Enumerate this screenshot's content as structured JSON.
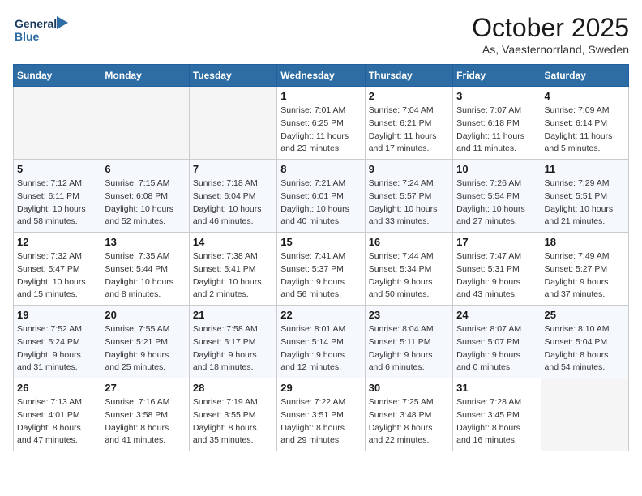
{
  "header": {
    "logo_line1": "General",
    "logo_line2": "Blue",
    "month": "October 2025",
    "location": "As, Vaesternorrland, Sweden"
  },
  "weekdays": [
    "Sunday",
    "Monday",
    "Tuesday",
    "Wednesday",
    "Thursday",
    "Friday",
    "Saturday"
  ],
  "weeks": [
    [
      {
        "day": "",
        "info": ""
      },
      {
        "day": "",
        "info": ""
      },
      {
        "day": "",
        "info": ""
      },
      {
        "day": "1",
        "info": "Sunrise: 7:01 AM\nSunset: 6:25 PM\nDaylight: 11 hours\nand 23 minutes."
      },
      {
        "day": "2",
        "info": "Sunrise: 7:04 AM\nSunset: 6:21 PM\nDaylight: 11 hours\nand 17 minutes."
      },
      {
        "day": "3",
        "info": "Sunrise: 7:07 AM\nSunset: 6:18 PM\nDaylight: 11 hours\nand 11 minutes."
      },
      {
        "day": "4",
        "info": "Sunrise: 7:09 AM\nSunset: 6:14 PM\nDaylight: 11 hours\nand 5 minutes."
      }
    ],
    [
      {
        "day": "5",
        "info": "Sunrise: 7:12 AM\nSunset: 6:11 PM\nDaylight: 10 hours\nand 58 minutes."
      },
      {
        "day": "6",
        "info": "Sunrise: 7:15 AM\nSunset: 6:08 PM\nDaylight: 10 hours\nand 52 minutes."
      },
      {
        "day": "7",
        "info": "Sunrise: 7:18 AM\nSunset: 6:04 PM\nDaylight: 10 hours\nand 46 minutes."
      },
      {
        "day": "8",
        "info": "Sunrise: 7:21 AM\nSunset: 6:01 PM\nDaylight: 10 hours\nand 40 minutes."
      },
      {
        "day": "9",
        "info": "Sunrise: 7:24 AM\nSunset: 5:57 PM\nDaylight: 10 hours\nand 33 minutes."
      },
      {
        "day": "10",
        "info": "Sunrise: 7:26 AM\nSunset: 5:54 PM\nDaylight: 10 hours\nand 27 minutes."
      },
      {
        "day": "11",
        "info": "Sunrise: 7:29 AM\nSunset: 5:51 PM\nDaylight: 10 hours\nand 21 minutes."
      }
    ],
    [
      {
        "day": "12",
        "info": "Sunrise: 7:32 AM\nSunset: 5:47 PM\nDaylight: 10 hours\nand 15 minutes."
      },
      {
        "day": "13",
        "info": "Sunrise: 7:35 AM\nSunset: 5:44 PM\nDaylight: 10 hours\nand 8 minutes."
      },
      {
        "day": "14",
        "info": "Sunrise: 7:38 AM\nSunset: 5:41 PM\nDaylight: 10 hours\nand 2 minutes."
      },
      {
        "day": "15",
        "info": "Sunrise: 7:41 AM\nSunset: 5:37 PM\nDaylight: 9 hours\nand 56 minutes."
      },
      {
        "day": "16",
        "info": "Sunrise: 7:44 AM\nSunset: 5:34 PM\nDaylight: 9 hours\nand 50 minutes."
      },
      {
        "day": "17",
        "info": "Sunrise: 7:47 AM\nSunset: 5:31 PM\nDaylight: 9 hours\nand 43 minutes."
      },
      {
        "day": "18",
        "info": "Sunrise: 7:49 AM\nSunset: 5:27 PM\nDaylight: 9 hours\nand 37 minutes."
      }
    ],
    [
      {
        "day": "19",
        "info": "Sunrise: 7:52 AM\nSunset: 5:24 PM\nDaylight: 9 hours\nand 31 minutes."
      },
      {
        "day": "20",
        "info": "Sunrise: 7:55 AM\nSunset: 5:21 PM\nDaylight: 9 hours\nand 25 minutes."
      },
      {
        "day": "21",
        "info": "Sunrise: 7:58 AM\nSunset: 5:17 PM\nDaylight: 9 hours\nand 18 minutes."
      },
      {
        "day": "22",
        "info": "Sunrise: 8:01 AM\nSunset: 5:14 PM\nDaylight: 9 hours\nand 12 minutes."
      },
      {
        "day": "23",
        "info": "Sunrise: 8:04 AM\nSunset: 5:11 PM\nDaylight: 9 hours\nand 6 minutes."
      },
      {
        "day": "24",
        "info": "Sunrise: 8:07 AM\nSunset: 5:07 PM\nDaylight: 9 hours\nand 0 minutes."
      },
      {
        "day": "25",
        "info": "Sunrise: 8:10 AM\nSunset: 5:04 PM\nDaylight: 8 hours\nand 54 minutes."
      }
    ],
    [
      {
        "day": "26",
        "info": "Sunrise: 7:13 AM\nSunset: 4:01 PM\nDaylight: 8 hours\nand 47 minutes."
      },
      {
        "day": "27",
        "info": "Sunrise: 7:16 AM\nSunset: 3:58 PM\nDaylight: 8 hours\nand 41 minutes."
      },
      {
        "day": "28",
        "info": "Sunrise: 7:19 AM\nSunset: 3:55 PM\nDaylight: 8 hours\nand 35 minutes."
      },
      {
        "day": "29",
        "info": "Sunrise: 7:22 AM\nSunset: 3:51 PM\nDaylight: 8 hours\nand 29 minutes."
      },
      {
        "day": "30",
        "info": "Sunrise: 7:25 AM\nSunset: 3:48 PM\nDaylight: 8 hours\nand 22 minutes."
      },
      {
        "day": "31",
        "info": "Sunrise: 7:28 AM\nSunset: 3:45 PM\nDaylight: 8 hours\nand 16 minutes."
      },
      {
        "day": "",
        "info": ""
      }
    ]
  ]
}
